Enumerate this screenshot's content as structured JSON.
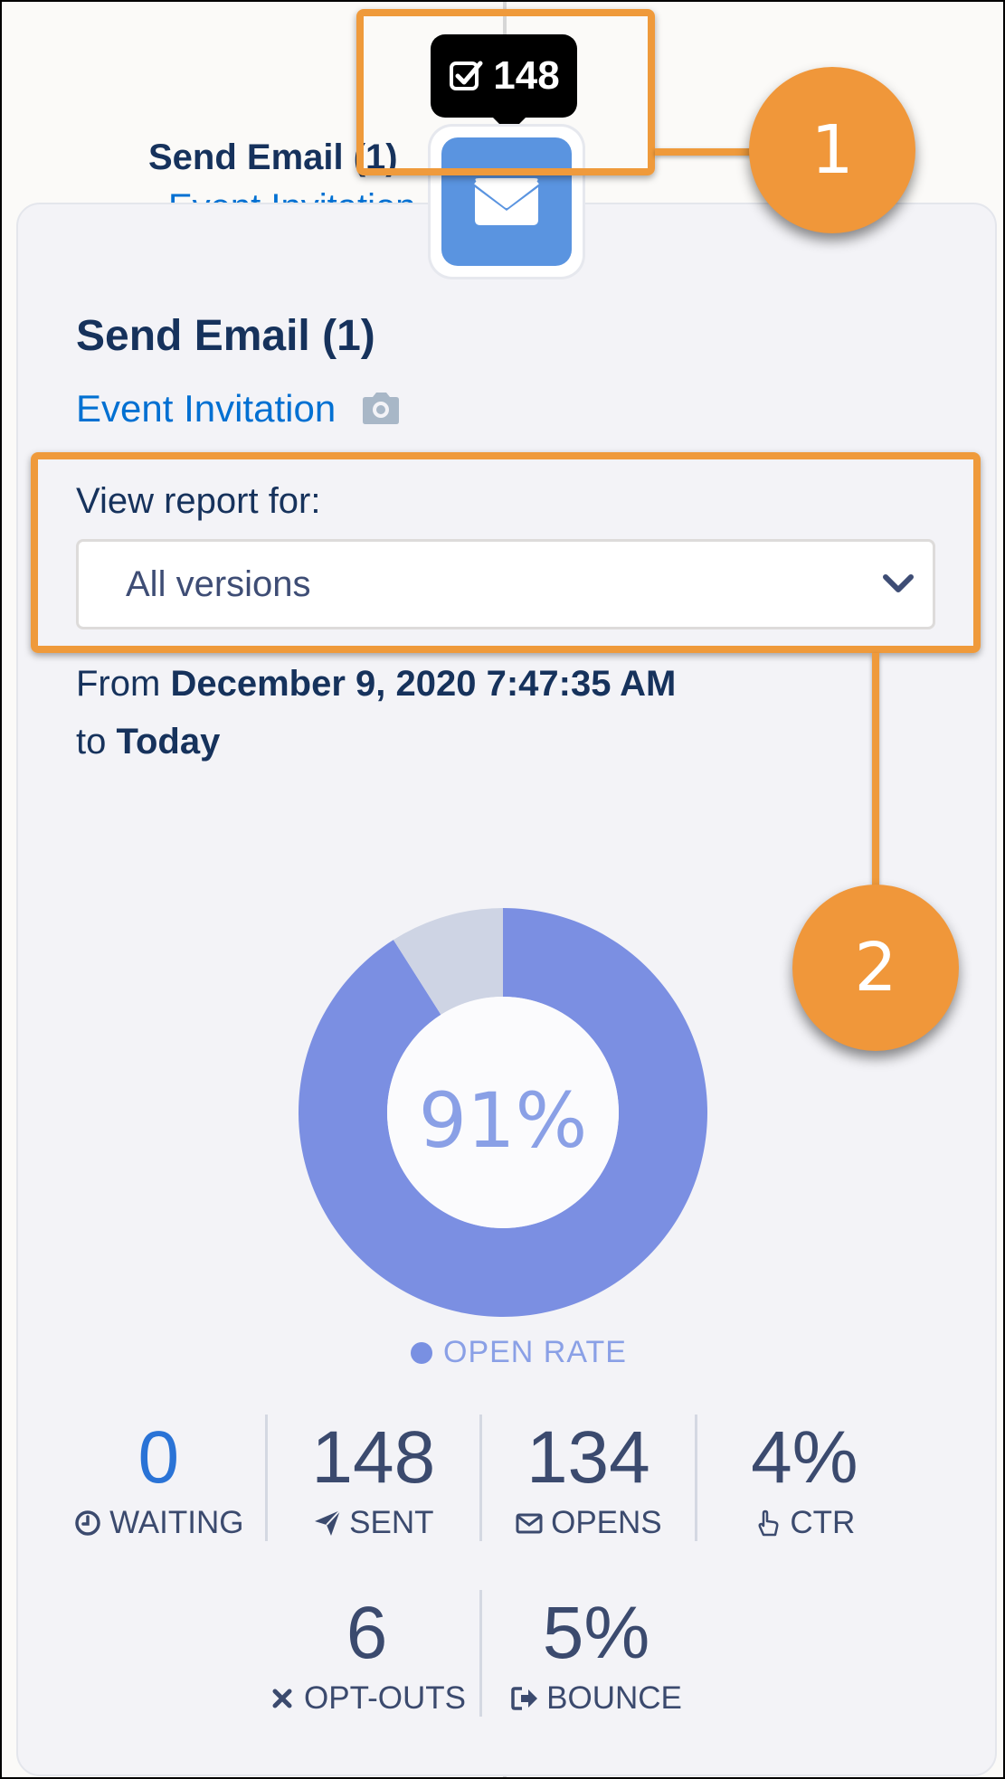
{
  "background_step": {
    "title": "Send Email (1)",
    "subtitle": "Event Invitation"
  },
  "tooltip": {
    "icon": "checkbox-icon",
    "count": "148"
  },
  "email_tile": {
    "icon": "email-envelope-icon",
    "color": "#5a94e0"
  },
  "callouts": [
    {
      "number": "1"
    },
    {
      "number": "2"
    }
  ],
  "step": {
    "title": "Send Email (1)",
    "link": "Event Invitation",
    "link_icon": "camera-icon"
  },
  "report": {
    "label": "View report for:",
    "selected": "All versions"
  },
  "date_range": {
    "from_prefix": "From",
    "from_value": "December 9, 2020 7:47:35 AM",
    "to_prefix": "to",
    "to_value": "Today"
  },
  "chart_data": {
    "type": "pie",
    "style": "donut",
    "center_label": "91%",
    "slices": [
      {
        "name": "OPEN RATE",
        "value": 91,
        "color": "#7b8fe2"
      },
      {
        "name": "",
        "value": 9,
        "color": "#ced4e4"
      }
    ],
    "legend": [
      {
        "name": "OPEN RATE",
        "color": "#7b8fe2"
      }
    ],
    "legend_position": "bottom"
  },
  "metrics": [
    {
      "value": "0",
      "label": "WAITING",
      "icon": "clock-icon",
      "accent": true
    },
    {
      "value": "148",
      "label": "SENT",
      "icon": "paper-plane-icon",
      "accent": false
    },
    {
      "value": "134",
      "label": "OPENS",
      "icon": "envelope-icon",
      "accent": false
    },
    {
      "value": "4%",
      "label": "CTR",
      "icon": "pointer-hand-icon",
      "accent": false
    },
    {
      "value": "6",
      "label": "OPT-OUTS",
      "icon": "x-icon",
      "accent": false
    },
    {
      "value": "5%",
      "label": "BOUNCE",
      "icon": "sign-out-icon",
      "accent": false
    }
  ],
  "colors": {
    "accent_orange": "#f0973a",
    "link_blue": "#0070d2",
    "navy_text": "#16325c",
    "donut_primary": "#7b8fe2",
    "donut_secondary": "#ced4e4"
  }
}
